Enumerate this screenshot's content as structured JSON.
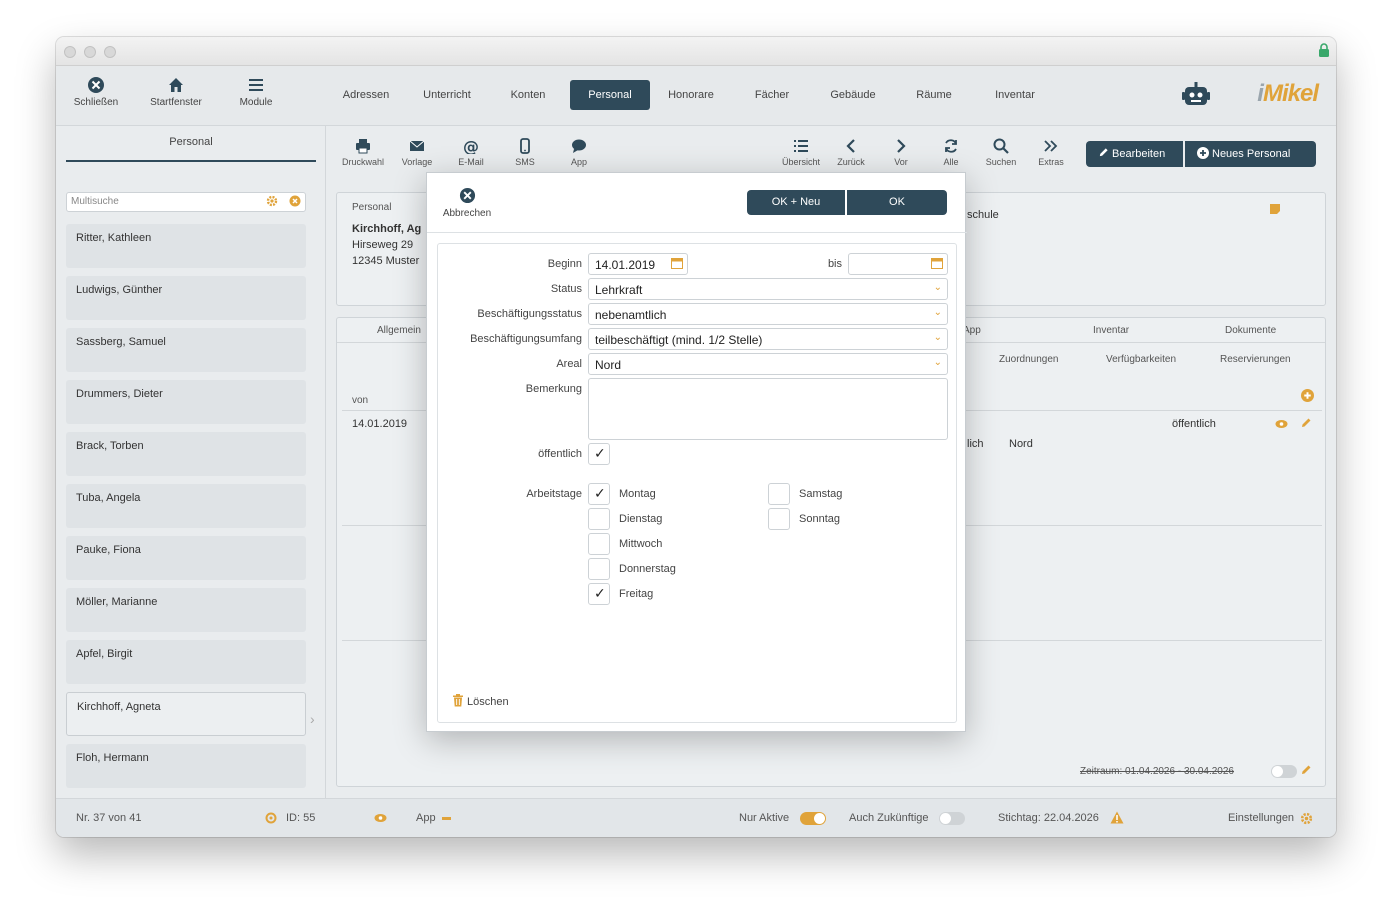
{
  "topbar": {
    "close_label": "Schließen",
    "start_label": "Startfenster",
    "modules_label": "Module",
    "tabs": [
      {
        "label": "Adressen"
      },
      {
        "label": "Unterricht"
      },
      {
        "label": "Konten"
      },
      {
        "label": "Personal"
      },
      {
        "label": "Honorare"
      },
      {
        "label": "Fächer"
      },
      {
        "label": "Gebäude"
      },
      {
        "label": "Räume"
      },
      {
        "label": "Inventar"
      }
    ],
    "active_tab": "Personal",
    "logo_i": "i",
    "logo_text": "Mikel"
  },
  "sidebar": {
    "tab_label": "Personal",
    "search_placeholder": "Multisuche",
    "items": [
      {
        "name": "Ritter, Kathleen"
      },
      {
        "name": "Ludwigs, Günther"
      },
      {
        "name": "Sassberg, Samuel"
      },
      {
        "name": "Drummers, Dieter"
      },
      {
        "name": "Brack, Torben"
      },
      {
        "name": "Tuba, Angela"
      },
      {
        "name": "Pauke, Fiona"
      },
      {
        "name": "Möller, Marianne"
      },
      {
        "name": "Apfel, Birgit"
      },
      {
        "name": "Kirchhoff, Agneta"
      },
      {
        "name": "Floh, Hermann"
      }
    ],
    "selected": "Kirchhoff, Agneta"
  },
  "actions": {
    "print": "Druckwahl",
    "template": "Vorlage",
    "email": "E-Mail",
    "sms": "SMS",
    "app": "App",
    "overview": "Übersicht",
    "back": "Zurück",
    "forward": "Vor",
    "all": "Alle",
    "search": "Suchen",
    "extras": "Extras",
    "edit": "Bearbeiten",
    "new_staff": "Neues Personal"
  },
  "detail": {
    "section_label": "Personal",
    "name_partial": "Kirchhoff, Ag",
    "street": "Hirseweg 29",
    "city_partial": "12345 Muster",
    "right_partial": "schule",
    "tabs_left": "Allgemein",
    "tabs_right": [
      "App",
      "Inventar",
      "Dokumente"
    ],
    "subtabs": [
      "Zuordnungen",
      "Verfügbarkeiten",
      "Reservierungen"
    ],
    "col_from": "von",
    "row_from": "14.01.2019",
    "row_public": "öffentlich",
    "row_partial": "lich",
    "row_area": "Nord",
    "period": "Zeitraum: 01.04.2026 - 30.04.2026"
  },
  "statusbar": {
    "record": "Nr. 37 von 41",
    "id": "ID: 55",
    "app": "App",
    "only_active": "Nur Aktive",
    "future": "Auch Zukünftige",
    "stichtag": "Stichtag: 22.04.2026",
    "settings": "Einstellungen"
  },
  "dialog": {
    "cancel_label": "Abbrechen",
    "ok_new_label": "OK + Neu",
    "ok_label": "OK",
    "begin_label": "Beginn",
    "begin_value": "14.01.2019",
    "until_label": "bis",
    "until_value": "",
    "status_label": "Status",
    "status_value": "Lehrkraft",
    "employment_status_label": "Beschäftigungsstatus",
    "employment_status_value": "nebenamtlich",
    "employment_scope_label": "Beschäftigungsumfang",
    "employment_scope_value": "teilbeschäftigt (mind. 1/2 Stelle)",
    "area_label": "Areal",
    "area_value": "Nord",
    "remark_label": "Bemerkung",
    "public_label": "öffentlich",
    "public_checked": true,
    "workdays_label": "Arbeitstage",
    "days": [
      {
        "label": "Montag",
        "checked": true
      },
      {
        "label": "Dienstag",
        "checked": false
      },
      {
        "label": "Mittwoch",
        "checked": false
      },
      {
        "label": "Donnerstag",
        "checked": false
      },
      {
        "label": "Freitag",
        "checked": true
      },
      {
        "label": "Samstag",
        "checked": false
      },
      {
        "label": "Sonntag",
        "checked": false
      }
    ],
    "delete_label": "Löschen"
  },
  "colors": {
    "accent": "#e0a33a",
    "primary": "#2f4a5a"
  }
}
